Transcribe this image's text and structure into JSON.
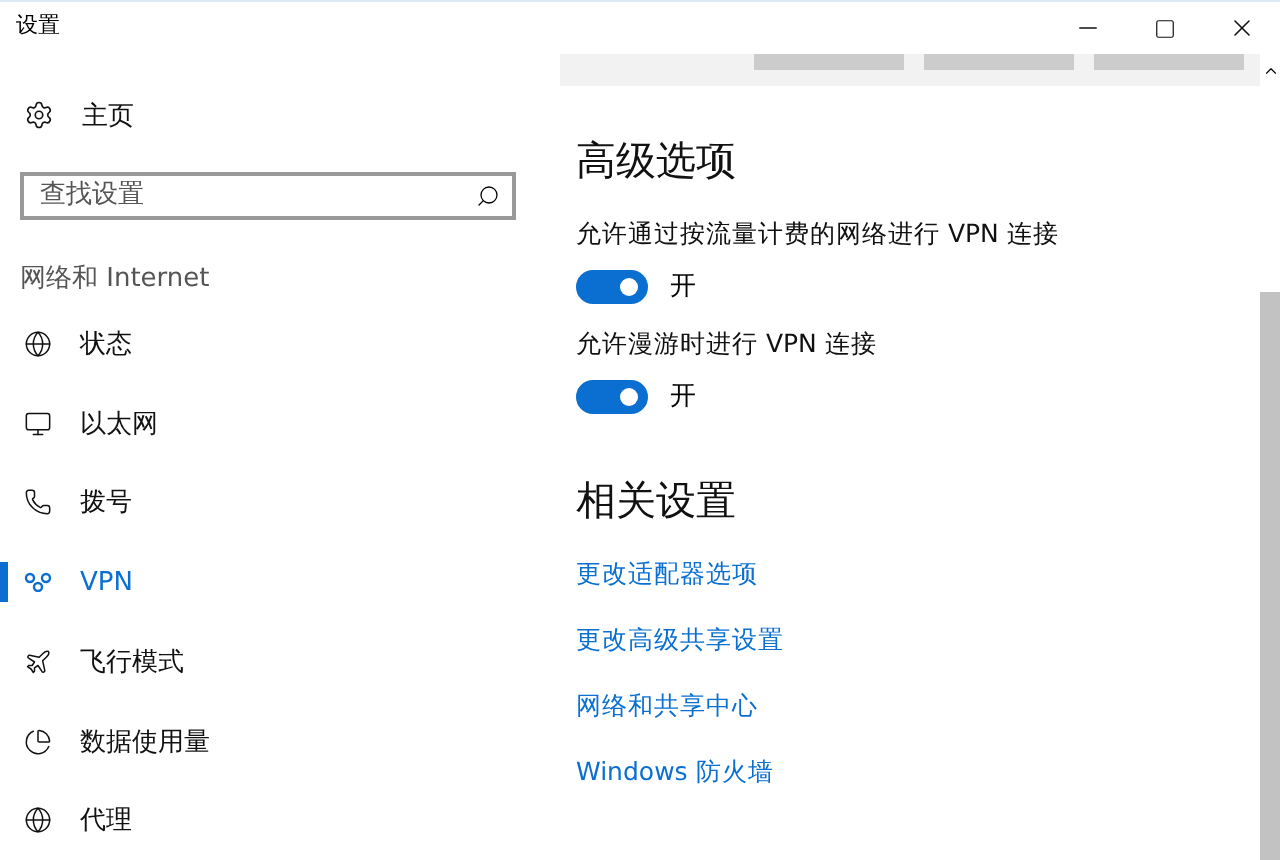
{
  "window": {
    "title": "设置"
  },
  "sidebar": {
    "home": "主页",
    "search": {
      "placeholder": "查找设置"
    },
    "section": "网络和 Internet",
    "items": [
      {
        "label": "状态",
        "selected": false
      },
      {
        "label": "以太网",
        "selected": false
      },
      {
        "label": "拨号",
        "selected": false
      },
      {
        "label": "VPN",
        "selected": true
      },
      {
        "label": "飞行模式",
        "selected": false
      },
      {
        "label": "数据使用量",
        "selected": false
      },
      {
        "label": "代理",
        "selected": false
      }
    ]
  },
  "advanced": {
    "heading": "高级选项",
    "options": [
      {
        "label": "允许通过按流量计费的网络进行 VPN 连接",
        "on": true,
        "state": "开"
      },
      {
        "label": "允许漫游时进行 VPN 连接",
        "on": true,
        "state": "开"
      }
    ]
  },
  "related": {
    "heading": "相关设置",
    "links": [
      "更改适配器选项",
      "更改高级共享设置",
      "网络和共享中心",
      "Windows 防火墙"
    ]
  }
}
